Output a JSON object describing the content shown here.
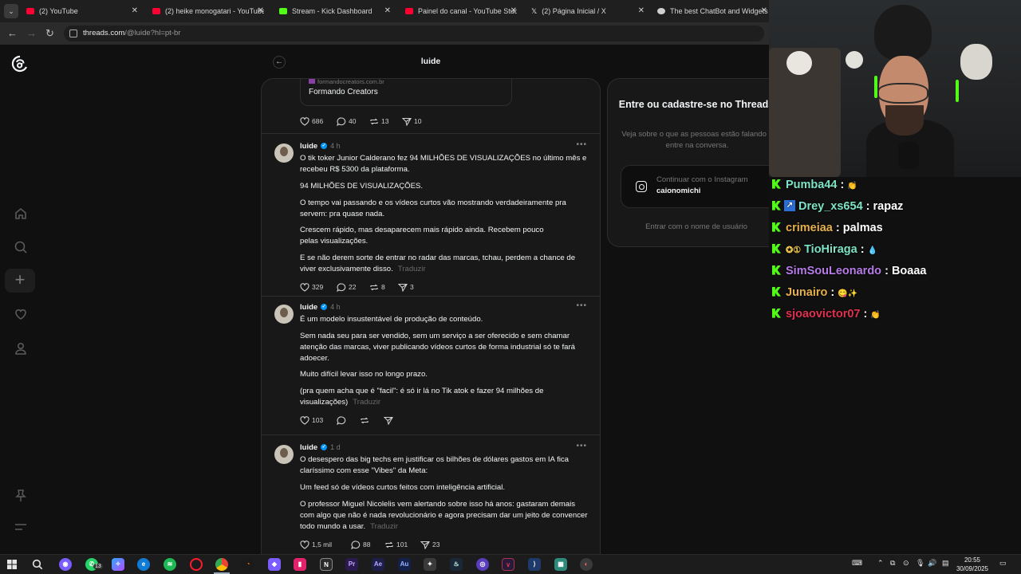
{
  "browser": {
    "tabs": [
      {
        "label": "(2) YouTube",
        "color": "#ff0033"
      },
      {
        "label": "(2) heike monogatari - YouTube",
        "color": "#ff0033"
      },
      {
        "label": "Stream - Kick Dashboard",
        "color": "#53fc18"
      },
      {
        "label": "Painel do canal - YouTube Stud",
        "color": "#ff0033"
      },
      {
        "label": "(2) Página Inicial / X",
        "color": "#e6e6e6"
      },
      {
        "label": "The best ChatBot and Widgets",
        "color": "#d0d0d0"
      }
    ],
    "url_main": "threads.com",
    "url_path": "/@luide?hl=pt-br"
  },
  "threads": {
    "header_title": "luide",
    "prev_post": {
      "link_domain": "formandocreators.com.br",
      "link_title": "Formando Creators",
      "likes": "686",
      "replies": "40",
      "reposts": "13",
      "shares": "10"
    },
    "posts": [
      {
        "author": "luide",
        "time": "4 h",
        "paragraphs": [
          "O tik toker Junior Calderano fez 94 MILHÕES DE VISUALIZAÇÕES no último mês e recebeu R$ 5300 da plataforma.",
          "94 MILHÕES DE VISUALIZAÇÕES.",
          "O tempo vai passando e os vídeos curtos vão mostrando verdadeiramente pra servem: pra quase nada.",
          "Crescem rápido, mas desaparecem mais rápido ainda. Recebem pouco pelas visualizações.",
          "E se não derem sorte de entrar no radar das marcas, tchau, perdem a chance de viver exclusivamente disso."
        ],
        "likes": "329",
        "replies": "22",
        "reposts": "8",
        "shares": "3"
      },
      {
        "author": "luide",
        "time": "4 h",
        "paragraphs": [
          "É um modelo insustentável de produção de conteúdo.",
          "Sem nada seu para ser vendido, sem um serviço a ser oferecido e sem chamar atenção das marcas, viver publicando vídeos curtos de forma industrial só te fará adoecer.",
          "Muito difícil levar isso no longo prazo.",
          "(pra quem acha que é \"facil\": é só ir lá no Tik atok e fazer 94 milhões de visualizações)"
        ],
        "likes": "103",
        "replies": "",
        "reposts": "",
        "shares": ""
      },
      {
        "author": "luide",
        "time": "1 d",
        "paragraphs": [
          "O desespero das big techs em justificar os bilhões de dólares gastos em IA fica claríssimo com esse \"Vibes\" da Meta:",
          "Um feed só de vídeos curtos feitos com inteligência artificial.",
          "O professor Miguel Nicolelis vem alertando sobre isso há anos: gastaram demais com algo que não é nada revolucionário e agora precisam dar um jeito de convencer todo mundo a usar."
        ],
        "likes": "1,5 mil",
        "replies": "88",
        "reposts": "101",
        "shares": "23"
      }
    ],
    "translate_label": "Traduzir",
    "login": {
      "title": "Entre ou cadastre-se no Threads",
      "subtitle": "Veja sobre o que as pessoas estão falando e entre na conversa.",
      "instagram_label": "Continuar com o Instagram",
      "instagram_user": "caionomichi",
      "username_login": "Entrar com o nome de usuário"
    }
  },
  "chat": [
    {
      "user": "Pumba44",
      "color": "#7de3c4",
      "message": "",
      "badge": ""
    },
    {
      "user": "Drey_xs654",
      "color": "#7de3c4",
      "message": "rapaz",
      "badge": "↗"
    },
    {
      "user": "crimeiaa",
      "color": "#e6b04d",
      "message": "palmas",
      "badge": ""
    },
    {
      "user": "TioHiraga",
      "color": "#7de3c4",
      "message": "",
      "badge": "✪①"
    },
    {
      "user": "SimSouLeonardo",
      "color": "#b57be6",
      "message": "Boaaa",
      "badge": ""
    },
    {
      "user": "Junairo",
      "color": "#e6b04d",
      "message": "",
      "badge": ""
    },
    {
      "user": "sjoaovictor07",
      "color": "#e0314f",
      "message": "",
      "badge": ""
    }
  ],
  "taskbar": {
    "whatsapp_badge": "13",
    "clock_time": "20:55",
    "clock_date": "30/09/2025"
  }
}
